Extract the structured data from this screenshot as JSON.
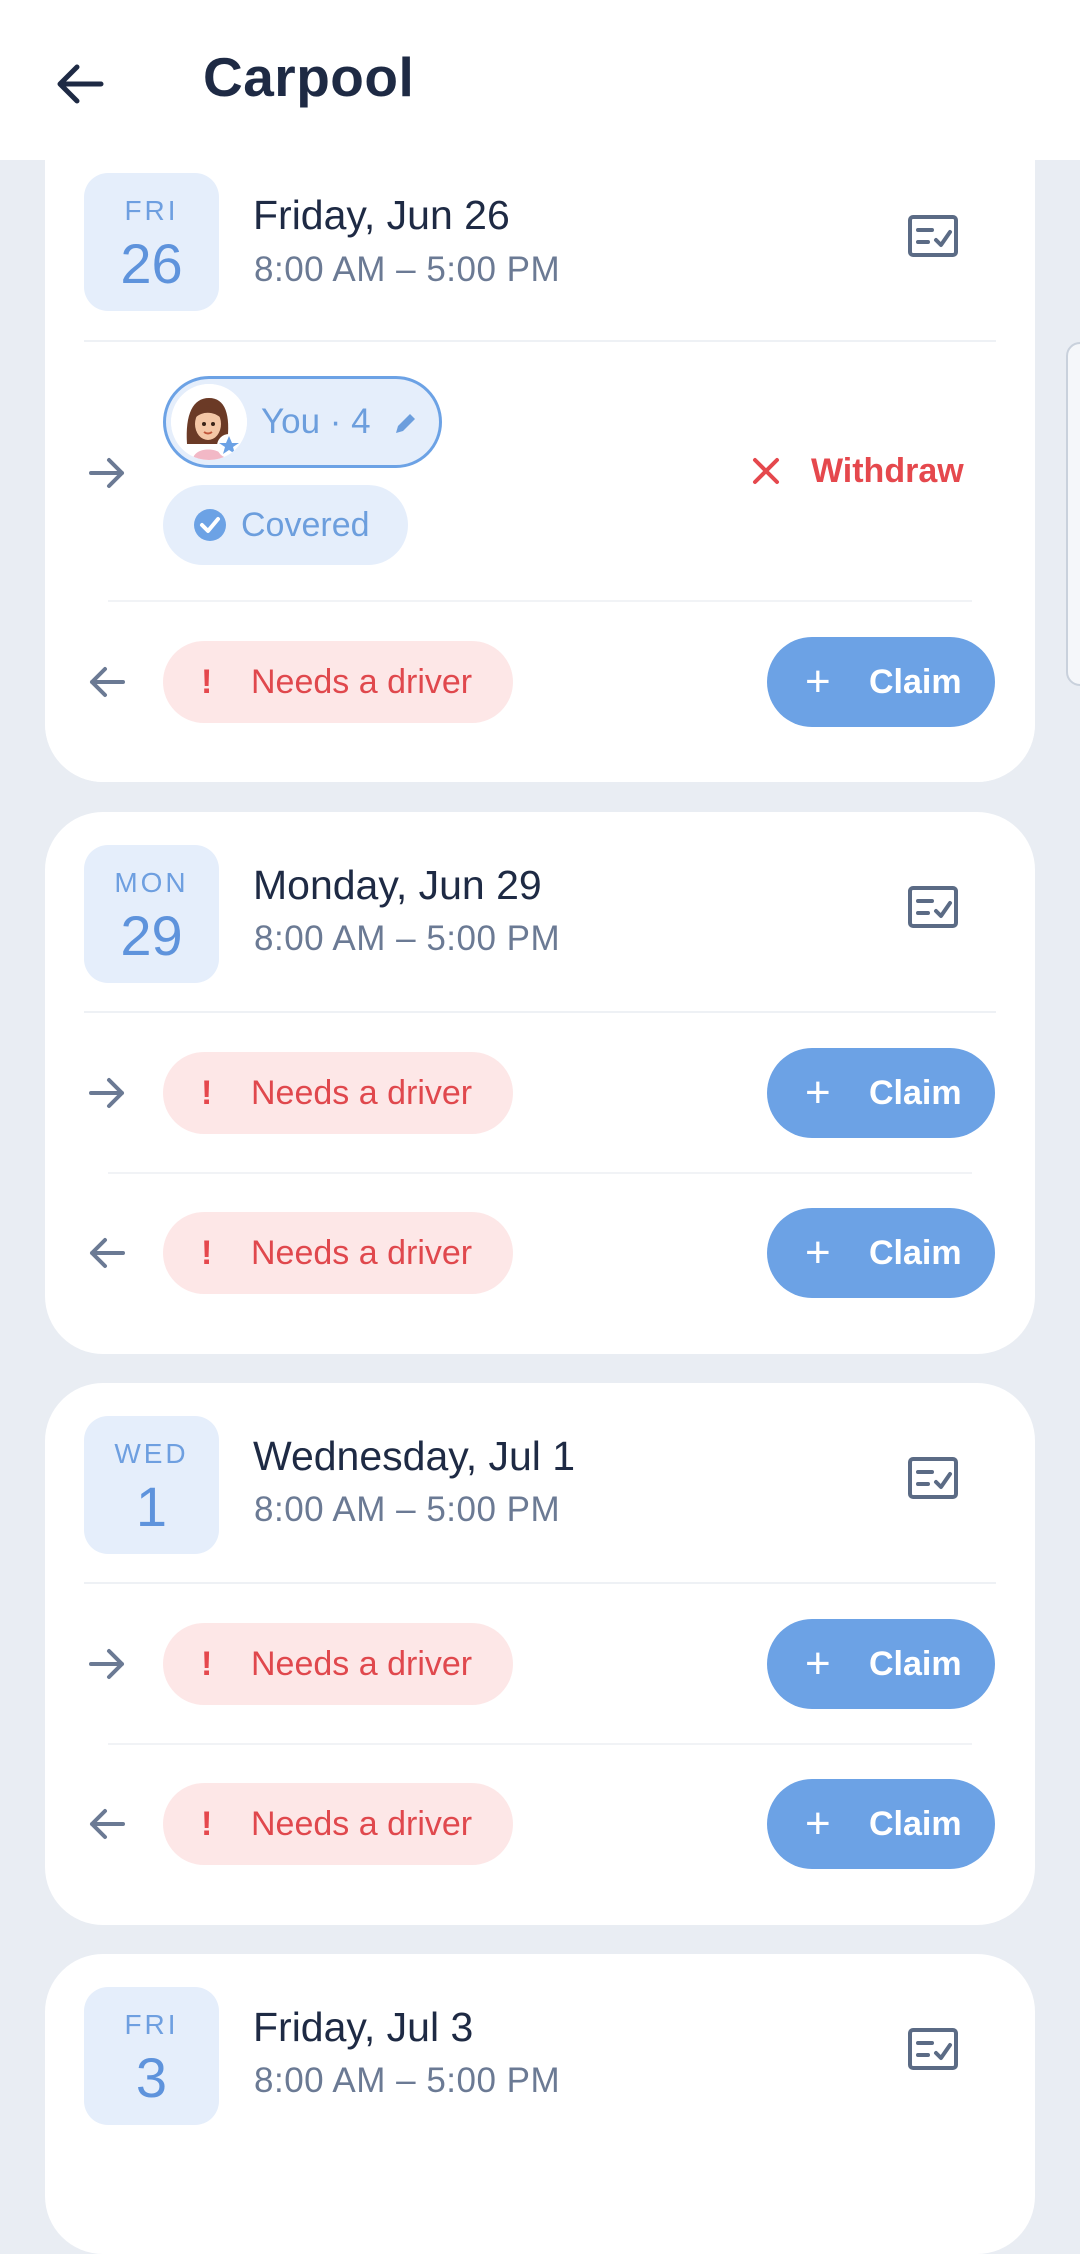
{
  "header": {
    "title": "Carpool",
    "back_icon": "arrow-left-icon"
  },
  "colors": {
    "accent": "#6CA2E5",
    "danger": "#E5484D",
    "danger_bg": "#FDE7E7",
    "date_bg": "#E5EEFB",
    "page_bg": "#E9EDF3"
  },
  "labels": {
    "needs_driver": "Needs a driver",
    "claim": "Claim",
    "withdraw": "Withdraw",
    "covered": "Covered",
    "you": "You · 4"
  },
  "days": [
    {
      "dow": "FRI",
      "num": "26",
      "full": "Friday, Jun 26",
      "time": "8:00 AM – 5:00 PM"
    },
    {
      "dow": "MON",
      "num": "29",
      "full": "Monday, Jun 29",
      "time": "8:00 AM – 5:00 PM"
    },
    {
      "dow": "WED",
      "num": "1",
      "full": "Wednesday, Jul 1",
      "time": "8:00 AM – 5:00 PM"
    },
    {
      "dow": "FRI",
      "num": "3",
      "full": "Friday, Jul 3",
      "time": "8:00 AM – 5:00 PM"
    }
  ]
}
